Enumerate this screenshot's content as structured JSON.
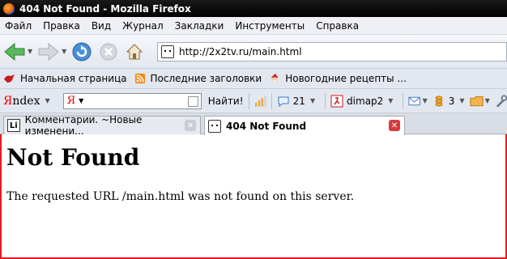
{
  "window": {
    "title": "404 Not Found - Mozilla Firefox"
  },
  "menu": [
    "Файл",
    "Правка",
    "Вид",
    "Журнал",
    "Закладки",
    "Инструменты",
    "Справка"
  ],
  "navigation": {
    "url": "http://2x2tv.ru/main.html"
  },
  "bookmarks": [
    {
      "label": "Начальная страница",
      "icon": "home-bird-icon"
    },
    {
      "label": "Последние заголовки",
      "icon": "rss-icon"
    },
    {
      "label": "Новогодние рецепты ...",
      "icon": "santa-icon"
    }
  ],
  "yandex": {
    "logo_ya": "Я",
    "logo_ndex": "ndex",
    "input_logo": "Я",
    "find_label": "Найти!",
    "comments_count": "21",
    "user_label": "dimap2",
    "coins_count": "3"
  },
  "tabs": [
    {
      "label": "Комментарии. ~Новые изменени...",
      "favicon": "Li",
      "active": false
    },
    {
      "label": "404 Not Found",
      "favicon": "face-icon",
      "active": true
    }
  ],
  "page": {
    "heading": "Not Found",
    "message": "The requested URL /main.html was not found on this server."
  },
  "colors": {
    "accent_red": "#e41c1c",
    "titlebar": "#000000"
  }
}
